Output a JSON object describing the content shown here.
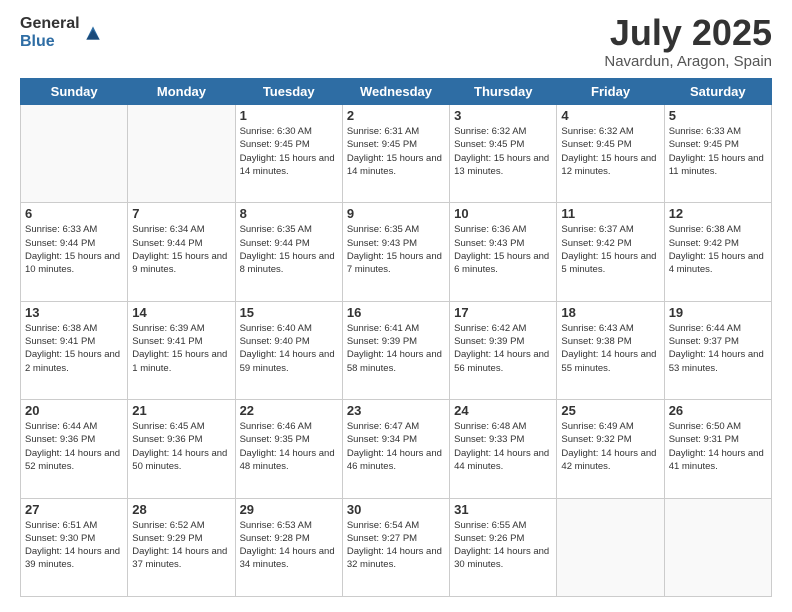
{
  "logo": {
    "general": "General",
    "blue": "Blue"
  },
  "header": {
    "month": "July 2025",
    "location": "Navardun, Aragon, Spain"
  },
  "weekdays": [
    "Sunday",
    "Monday",
    "Tuesday",
    "Wednesday",
    "Thursday",
    "Friday",
    "Saturday"
  ],
  "weeks": [
    [
      {
        "day": "",
        "info": ""
      },
      {
        "day": "",
        "info": ""
      },
      {
        "day": "1",
        "info": "Sunrise: 6:30 AM\nSunset: 9:45 PM\nDaylight: 15 hours and 14 minutes."
      },
      {
        "day": "2",
        "info": "Sunrise: 6:31 AM\nSunset: 9:45 PM\nDaylight: 15 hours and 14 minutes."
      },
      {
        "day": "3",
        "info": "Sunrise: 6:32 AM\nSunset: 9:45 PM\nDaylight: 15 hours and 13 minutes."
      },
      {
        "day": "4",
        "info": "Sunrise: 6:32 AM\nSunset: 9:45 PM\nDaylight: 15 hours and 12 minutes."
      },
      {
        "day": "5",
        "info": "Sunrise: 6:33 AM\nSunset: 9:45 PM\nDaylight: 15 hours and 11 minutes."
      }
    ],
    [
      {
        "day": "6",
        "info": "Sunrise: 6:33 AM\nSunset: 9:44 PM\nDaylight: 15 hours and 10 minutes."
      },
      {
        "day": "7",
        "info": "Sunrise: 6:34 AM\nSunset: 9:44 PM\nDaylight: 15 hours and 9 minutes."
      },
      {
        "day": "8",
        "info": "Sunrise: 6:35 AM\nSunset: 9:44 PM\nDaylight: 15 hours and 8 minutes."
      },
      {
        "day": "9",
        "info": "Sunrise: 6:35 AM\nSunset: 9:43 PM\nDaylight: 15 hours and 7 minutes."
      },
      {
        "day": "10",
        "info": "Sunrise: 6:36 AM\nSunset: 9:43 PM\nDaylight: 15 hours and 6 minutes."
      },
      {
        "day": "11",
        "info": "Sunrise: 6:37 AM\nSunset: 9:42 PM\nDaylight: 15 hours and 5 minutes."
      },
      {
        "day": "12",
        "info": "Sunrise: 6:38 AM\nSunset: 9:42 PM\nDaylight: 15 hours and 4 minutes."
      }
    ],
    [
      {
        "day": "13",
        "info": "Sunrise: 6:38 AM\nSunset: 9:41 PM\nDaylight: 15 hours and 2 minutes."
      },
      {
        "day": "14",
        "info": "Sunrise: 6:39 AM\nSunset: 9:41 PM\nDaylight: 15 hours and 1 minute."
      },
      {
        "day": "15",
        "info": "Sunrise: 6:40 AM\nSunset: 9:40 PM\nDaylight: 14 hours and 59 minutes."
      },
      {
        "day": "16",
        "info": "Sunrise: 6:41 AM\nSunset: 9:39 PM\nDaylight: 14 hours and 58 minutes."
      },
      {
        "day": "17",
        "info": "Sunrise: 6:42 AM\nSunset: 9:39 PM\nDaylight: 14 hours and 56 minutes."
      },
      {
        "day": "18",
        "info": "Sunrise: 6:43 AM\nSunset: 9:38 PM\nDaylight: 14 hours and 55 minutes."
      },
      {
        "day": "19",
        "info": "Sunrise: 6:44 AM\nSunset: 9:37 PM\nDaylight: 14 hours and 53 minutes."
      }
    ],
    [
      {
        "day": "20",
        "info": "Sunrise: 6:44 AM\nSunset: 9:36 PM\nDaylight: 14 hours and 52 minutes."
      },
      {
        "day": "21",
        "info": "Sunrise: 6:45 AM\nSunset: 9:36 PM\nDaylight: 14 hours and 50 minutes."
      },
      {
        "day": "22",
        "info": "Sunrise: 6:46 AM\nSunset: 9:35 PM\nDaylight: 14 hours and 48 minutes."
      },
      {
        "day": "23",
        "info": "Sunrise: 6:47 AM\nSunset: 9:34 PM\nDaylight: 14 hours and 46 minutes."
      },
      {
        "day": "24",
        "info": "Sunrise: 6:48 AM\nSunset: 9:33 PM\nDaylight: 14 hours and 44 minutes."
      },
      {
        "day": "25",
        "info": "Sunrise: 6:49 AM\nSunset: 9:32 PM\nDaylight: 14 hours and 42 minutes."
      },
      {
        "day": "26",
        "info": "Sunrise: 6:50 AM\nSunset: 9:31 PM\nDaylight: 14 hours and 41 minutes."
      }
    ],
    [
      {
        "day": "27",
        "info": "Sunrise: 6:51 AM\nSunset: 9:30 PM\nDaylight: 14 hours and 39 minutes."
      },
      {
        "day": "28",
        "info": "Sunrise: 6:52 AM\nSunset: 9:29 PM\nDaylight: 14 hours and 37 minutes."
      },
      {
        "day": "29",
        "info": "Sunrise: 6:53 AM\nSunset: 9:28 PM\nDaylight: 14 hours and 34 minutes."
      },
      {
        "day": "30",
        "info": "Sunrise: 6:54 AM\nSunset: 9:27 PM\nDaylight: 14 hours and 32 minutes."
      },
      {
        "day": "31",
        "info": "Sunrise: 6:55 AM\nSunset: 9:26 PM\nDaylight: 14 hours and 30 minutes."
      },
      {
        "day": "",
        "info": ""
      },
      {
        "day": "",
        "info": ""
      }
    ]
  ]
}
